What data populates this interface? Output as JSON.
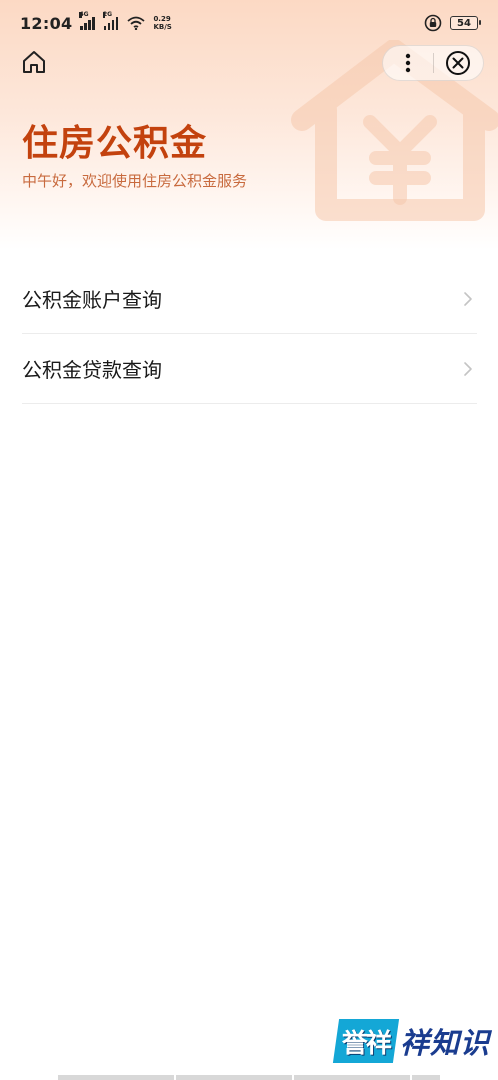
{
  "status_bar": {
    "time": "12:04",
    "sim1_tag": "4G",
    "sim2_tag": "2G",
    "net_speed_value": "0.29",
    "net_speed_unit": "KB/S",
    "battery": "54"
  },
  "header": {
    "title": "住房公积金",
    "greeting": "中午好，欢迎使用住房公积金服务"
  },
  "menu": {
    "items": [
      {
        "label": "公积金账户查询"
      },
      {
        "label": "公积金贷款查询"
      }
    ]
  },
  "watermark": {
    "badge": "誉祥",
    "text": "祥知识"
  },
  "colors": {
    "accent": "#c3420e",
    "subtitle": "#c86a3e",
    "hero_top": "#fcd9c4",
    "brand_blue": "#1a3c8f",
    "brand_cyan": "#14a7d6"
  }
}
